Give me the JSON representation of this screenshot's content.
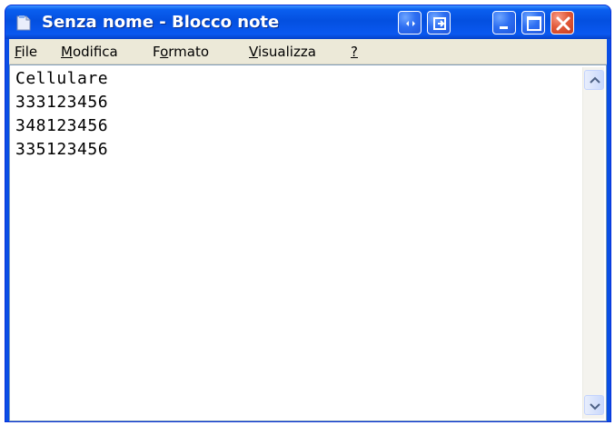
{
  "window": {
    "title": "Senza nome - Blocco note"
  },
  "menu": {
    "items": [
      {
        "label": "File",
        "mnemonic": "F"
      },
      {
        "label": "Modifica",
        "mnemonic": "M"
      },
      {
        "label": "Formato",
        "mnemonic": "o"
      },
      {
        "label": "Visualizza",
        "mnemonic": "V"
      },
      {
        "label": "?",
        "mnemonic": "?"
      }
    ]
  },
  "editor": {
    "content": "Cellulare\n333123456\n348123456\n335123456"
  },
  "icons": {
    "app": "notepad-icon",
    "title_buttons": [
      "expand-icon",
      "restore-window-icon",
      "minimize-icon",
      "maximize-icon",
      "close-icon"
    ]
  },
  "colors": {
    "titlebar": "#0450e0",
    "close_button": "#e25b3a",
    "menubar": "#ece9d8"
  }
}
